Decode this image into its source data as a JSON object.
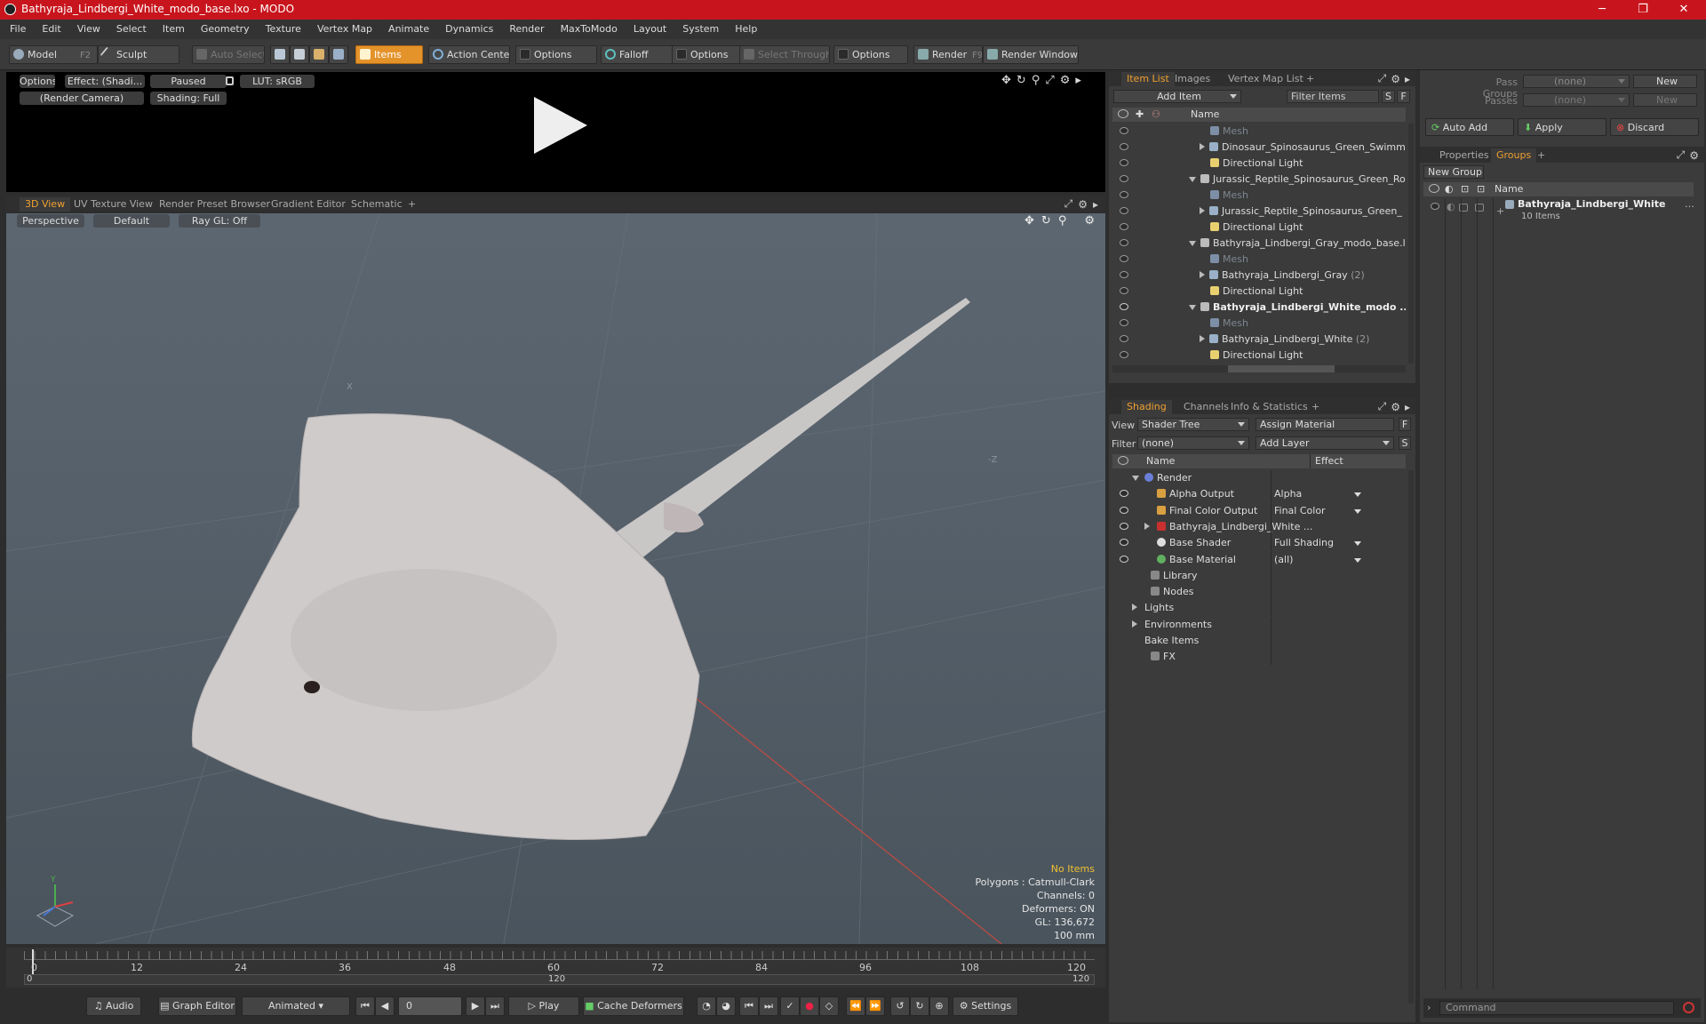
{
  "window": {
    "title": "Bathyraja_Lindbergi_White_modo_base.lxo - MODO",
    "minimize": "─",
    "maximize": "❐",
    "close": "✕"
  },
  "menu": [
    "File",
    "Edit",
    "View",
    "Select",
    "Item",
    "Geometry",
    "Texture",
    "Vertex Map",
    "Animate",
    "Dynamics",
    "Render",
    "MaxToModo",
    "Layout",
    "System",
    "Help"
  ],
  "toolbar": {
    "model": "Model",
    "model_key": "F2",
    "sculpt": "Sculpt",
    "auto_select": "Auto Select",
    "items": "Items",
    "action_center": "Action Center",
    "options1": "Options",
    "falloff": "Falloff",
    "options2": "Options",
    "select_through": "Select Through",
    "options3": "Options",
    "render": "Render",
    "render_key": "F9",
    "render_window": "Render Window"
  },
  "render_preview": {
    "options": "Options",
    "effect": "Effect: (Shadi...",
    "paused": "Paused",
    "lut": "LUT: sRGB",
    "camera": "(Render Camera)",
    "shading": "Shading: Full"
  },
  "viewport_tabs": [
    "3D View",
    "UV Texture View",
    "Render Preset Browser",
    "Gradient Editor",
    "Schematic",
    "+"
  ],
  "viewport": {
    "perspective": "Perspective",
    "default": "Default",
    "raygl": "Ray GL: Off",
    "stats": {
      "no_items": "No Items",
      "polygons": "Polygons : Catmull-Clark",
      "channels": "Channels: 0",
      "deformers": "Deformers: ON",
      "gl": "GL: 136,672",
      "scale": "100 mm"
    },
    "axis_x": "X",
    "axis_y": "Y",
    "axis_z": "Z"
  },
  "timeline": {
    "ticks": [
      "0",
      "12",
      "24",
      "36",
      "48",
      "60",
      "72",
      "84",
      "96",
      "108",
      "120"
    ],
    "start": "0",
    "mid": "120",
    "end": "120"
  },
  "transport": {
    "audio": "Audio",
    "graph_editor": "Graph Editor",
    "animated": "Animated",
    "frame": "0",
    "play": "Play",
    "cache_deformers": "Cache Deformers",
    "settings": "Settings"
  },
  "item_list": {
    "tabs": [
      "Item List",
      "Images",
      "Vertex Map List",
      "+"
    ],
    "add_item": "Add Item",
    "filter_items": "Filter Items",
    "s": "S",
    "f": "F",
    "col_name": "Name",
    "rows": [
      {
        "label": "Mesh",
        "indent": 3,
        "kind": "mesh",
        "dim": true
      },
      {
        "label": "Dinosaur_Spinosaurus_Green_Swimmi ...",
        "indent": 2,
        "kind": "group"
      },
      {
        "label": "Directional Light",
        "indent": 3,
        "kind": "light"
      },
      {
        "label": "Jurassic_Reptile_Spinosaurus_Green_Ro ...",
        "indent": 1,
        "kind": "scene"
      },
      {
        "label": "Mesh",
        "indent": 3,
        "kind": "mesh",
        "dim": true
      },
      {
        "label": "Jurassic_Reptile_Spinosaurus_Green_ ...",
        "indent": 2,
        "kind": "group"
      },
      {
        "label": "Directional Light",
        "indent": 3,
        "kind": "light"
      },
      {
        "label": "Bathyraja_Lindbergi_Gray_modo_base.lxo",
        "indent": 1,
        "kind": "scene"
      },
      {
        "label": "Mesh",
        "indent": 3,
        "kind": "mesh",
        "dim": true
      },
      {
        "label": "Bathyraja_Lindbergi_Gray",
        "suffix": "(2)",
        "indent": 2,
        "kind": "group"
      },
      {
        "label": "Directional Light",
        "indent": 3,
        "kind": "light"
      },
      {
        "label": "Bathyraja_Lindbergi_White_modo ...",
        "indent": 1,
        "kind": "scene",
        "bold": true
      },
      {
        "label": "Mesh",
        "indent": 3,
        "kind": "mesh",
        "dim": true
      },
      {
        "label": "Bathyraja_Lindbergi_White",
        "suffix": "(2)",
        "indent": 2,
        "kind": "group"
      },
      {
        "label": "Directional Light",
        "indent": 3,
        "kind": "light"
      }
    ]
  },
  "shading": {
    "tabs": [
      "Shading",
      "Channels",
      "Info & Statistics",
      "+"
    ],
    "view_label": "View",
    "view_value": "Shader Tree",
    "assign_material": "Assign Material",
    "filter_label": "Filter",
    "filter_value": "(none)",
    "add_layer": "Add Layer",
    "f": "F",
    "s": "S",
    "col_name": "Name",
    "col_effect": "Effect",
    "rows": [
      {
        "label": "Render",
        "effect": "",
        "indent": 0,
        "color": "#6a7fd8",
        "eye": false,
        "expander": "open"
      },
      {
        "label": "Alpha Output",
        "effect": "Alpha",
        "indent": 1,
        "color": "#d8a040",
        "eye": true
      },
      {
        "label": "Final Color Output",
        "effect": "Final Color",
        "indent": 1,
        "color": "#d8a040",
        "eye": true
      },
      {
        "label": "Bathyraja_Lindbergi_White ...",
        "effect": "",
        "indent": 1,
        "color": "#c83030",
        "eye": true,
        "expander": "closed"
      },
      {
        "label": "Base Shader",
        "effect": "Full Shading",
        "indent": 1,
        "color": "#dddddd",
        "eye": true
      },
      {
        "label": "Base Material",
        "effect": "(all)",
        "indent": 1,
        "color": "#60b060",
        "eye": true
      },
      {
        "label": "Library",
        "effect": "",
        "indent": 0.5,
        "color": "#888888",
        "eye": false
      },
      {
        "label": "Nodes",
        "effect": "",
        "indent": 0.5,
        "color": "#888888",
        "eye": false
      },
      {
        "label": "Lights",
        "effect": "",
        "indent": 0,
        "color": "",
        "eye": false,
        "expander": "closed"
      },
      {
        "label": "Environments",
        "effect": "",
        "indent": 0,
        "color": "",
        "eye": false,
        "expander": "closed"
      },
      {
        "label": "Bake Items",
        "effect": "",
        "indent": 0,
        "color": "",
        "eye": false
      },
      {
        "label": "FX",
        "effect": "",
        "indent": 0.5,
        "color": "#888888",
        "eye": false
      }
    ]
  },
  "right_panel": {
    "pass_groups_label": "Pass Groups",
    "pass_groups_value": "(none)",
    "new": "New",
    "passes_label": "Passes",
    "passes_value": "(none)",
    "new2": "New",
    "auto_add": "Auto Add",
    "apply": "Apply",
    "discard": "Discard",
    "tabs": [
      "Properties",
      "Groups",
      "+"
    ],
    "new_group": "New Group",
    "col_name": "Name",
    "group_name": "Bathyraja_Lindbergi_White",
    "group_count": "10 Items",
    "command_placeholder": "Command"
  }
}
